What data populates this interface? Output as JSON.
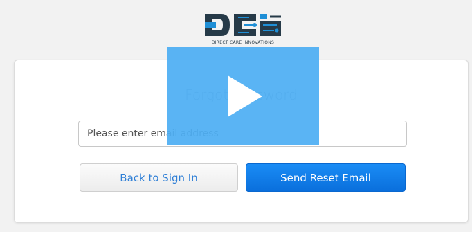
{
  "logo": {
    "caption": "DIRECT CARE INNOVATIONS",
    "letters": "DCI",
    "colors": {
      "dark": "#263a48",
      "blue": "#1f8fd6"
    },
    "icon_name": "dci-logo"
  },
  "form": {
    "title": "Forgot Password",
    "email_placeholder": "Please enter email address",
    "email_value": "",
    "back_label": "Back to Sign In",
    "send_label": "Send Reset Email"
  },
  "video_overlay": {
    "icon_name": "play-icon",
    "color": "#4daef3"
  },
  "colors": {
    "primary_button": "#0a78e8",
    "link_text": "#2f7fd6",
    "title_text": "#9aa1aa"
  }
}
